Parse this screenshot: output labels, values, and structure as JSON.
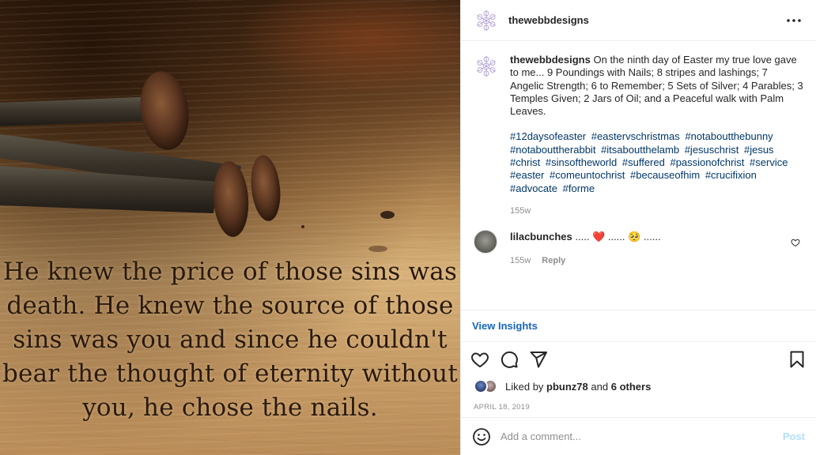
{
  "post": {
    "username": "thewebbdesigns",
    "image": {
      "quote_lines": [
        "He knew the price of those sins was",
        "death. He knew the source of those",
        "sins was you and since he couldn't",
        "bear the thought of eternity without",
        "you, he chose the nails."
      ]
    },
    "caption": {
      "username": "thewebbdesigns",
      "text": "On the ninth day of Easter my true love gave to me... 9 Poundings with Nails; 8 stripes and lashings; 7 Angelic Strength; 6 to Remember; 5 Sets of Silver; 4 Parables; 3 Temples Given; 2 Jars of Oil; and a Peaceful walk with Palm Leaves.",
      "hashtags": [
        "#12daysofeaster",
        "#eastervschristmas",
        "#notaboutthebunny",
        "#notabouttherabbit",
        "#itsaboutthelamb",
        "#jesuschrist",
        "#jesus",
        "#christ",
        "#sinsoftheworld",
        "#suffered",
        "#passionofchrist",
        "#service",
        "#easter",
        "#comeuntochrist",
        "#becauseofhim",
        "#crucifixion",
        "#advocate",
        "#forme"
      ],
      "time": "155w"
    },
    "comments": [
      {
        "username": "lilacbunches",
        "text": "..... ❤️ ...... 🥺 ......",
        "time": "155w",
        "reply_label": "Reply"
      }
    ],
    "view_insights": "View Insights",
    "likes": {
      "prefix": "Liked by",
      "first_user": "pbunz78",
      "and": "and",
      "others": "6 others"
    },
    "date": "April 18, 2019",
    "add_comment": {
      "placeholder": "Add a comment...",
      "post_label": "Post"
    },
    "more_label": "•••"
  },
  "colors": {
    "link": "#00376b",
    "insights": "#1565c0",
    "post_disabled": "#b2dffc",
    "muted": "#8e8e8e",
    "heart": "#ed4956"
  },
  "icons": [
    "logo-snowflake-icon",
    "more-icon",
    "heart-icon",
    "comment-icon",
    "share-icon",
    "save-icon",
    "emoji-icon",
    "heart-small-icon"
  ]
}
